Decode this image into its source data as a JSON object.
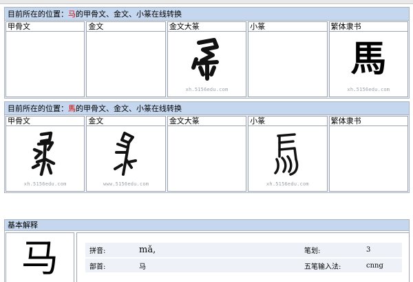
{
  "section1": {
    "header_prefix": "目前所在的位置：",
    "header_char": "马",
    "header_suffix": "的甲骨文、金文、小篆在线转换",
    "columns": [
      {
        "label": "甲骨文",
        "glyph": "",
        "watermark": ""
      },
      {
        "label": "金文",
        "glyph": "",
        "watermark": ""
      },
      {
        "label": "金文大篆",
        "glyph": "seal-ma-icon",
        "watermark": "xh.5156edu.com"
      },
      {
        "label": "小篆",
        "glyph": "",
        "watermark": ""
      },
      {
        "label": "繁体隶书",
        "glyph": "馬",
        "watermark": "xh.5156edu.com"
      }
    ]
  },
  "section2": {
    "header_prefix": "目前所在的位置：",
    "header_char": "馬",
    "header_suffix": "的甲骨文、金文、小篆在线转换",
    "columns": [
      {
        "label": "甲骨文",
        "glyph": "oracle-horse-icon",
        "watermark": "xh.5156edu.com"
      },
      {
        "label": "金文",
        "glyph": "bronze-horse-icon",
        "watermark": "www.5156edu.com"
      },
      {
        "label": "金文大篆",
        "glyph": "",
        "watermark": ""
      },
      {
        "label": "小篆",
        "glyph": "small-seal-horse-icon",
        "watermark": "xh.5156edu.com"
      },
      {
        "label": "繁体隶书",
        "glyph": "",
        "watermark": ""
      }
    ]
  },
  "basic": {
    "title": "基本解释",
    "char": "马",
    "pinyin_label": "拼音:",
    "pinyin_value": "mǎ,",
    "strokes_label": "笔划:",
    "strokes_value": "3",
    "radical_label": "部首:",
    "radical_value": "马",
    "wubi_label": "五笔输入法:",
    "wubi_value": "cnng"
  }
}
